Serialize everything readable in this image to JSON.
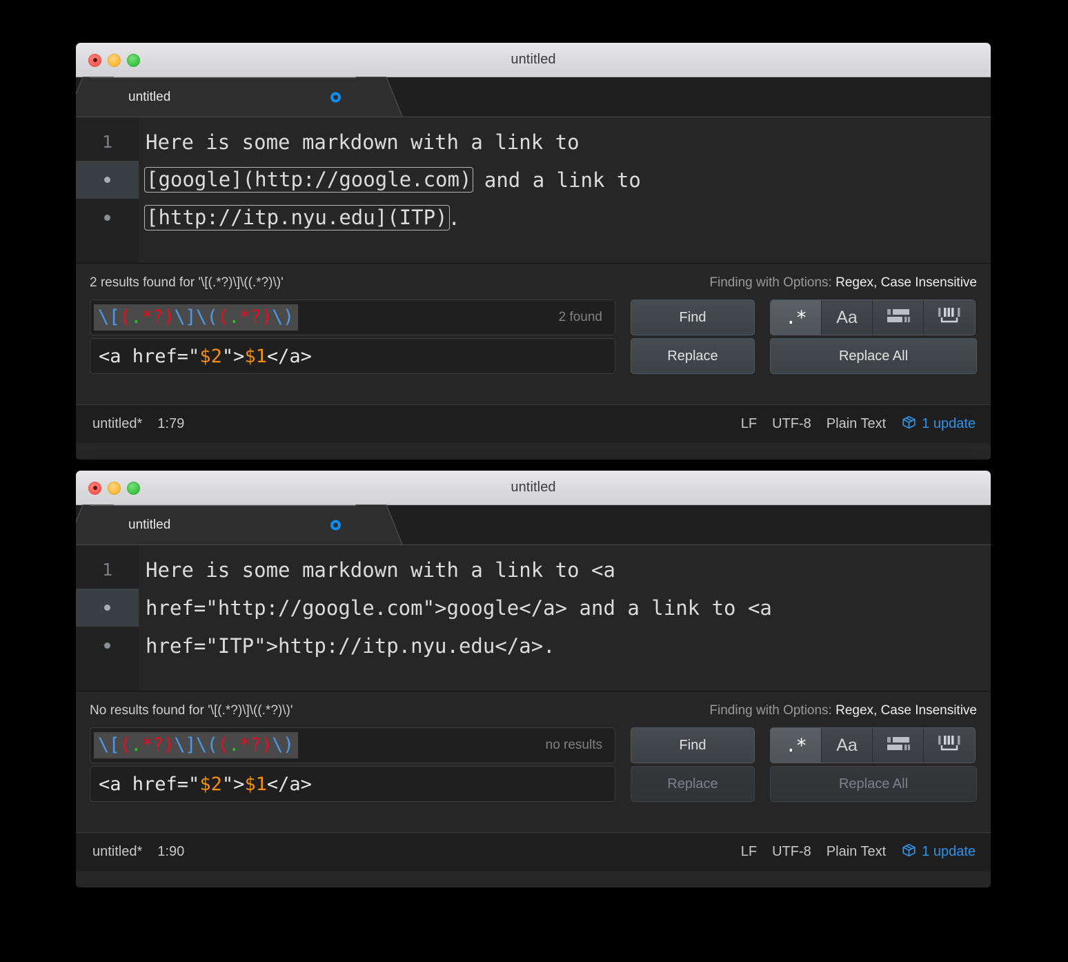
{
  "windows": [
    {
      "title": "untitled",
      "tab": {
        "label": "untitled",
        "dirty_icon": "unsaved-dot-icon"
      },
      "editor": {
        "line_number": "1",
        "lines": [
          {
            "segments": [
              {
                "text": "Here is some markdown with a link to",
                "match": false
              }
            ]
          },
          {
            "segments": [
              {
                "text": "[google](http://google.com)",
                "match": true
              },
              {
                "text": " and a link to",
                "match": false
              }
            ]
          },
          {
            "segments": [
              {
                "text": "[http://itp.nyu.edu](ITP)",
                "match": true
              },
              {
                "text": ".",
                "match": false
              }
            ]
          }
        ]
      },
      "find": {
        "status": "2 results found for '\\[(.*?)\\]\\((.*?)\\)'",
        "options_label": "Finding with Options:",
        "options_value": "Regex, Case Insensitive",
        "query_tokens": [
          {
            "t": "\\[",
            "c": "esc"
          },
          {
            "t": "(",
            "c": "grp"
          },
          {
            "t": ".",
            "c": "dot"
          },
          {
            "t": "*?",
            "c": "grp"
          },
          {
            "t": ")",
            "c": "grp"
          },
          {
            "t": "\\]",
            "c": "esc"
          },
          {
            "t": "\\(",
            "c": "esc"
          },
          {
            "t": "(",
            "c": "grp"
          },
          {
            "t": ".",
            "c": "dot"
          },
          {
            "t": "*?",
            "c": "grp"
          },
          {
            "t": ")",
            "c": "grp"
          },
          {
            "t": "\\)",
            "c": "esc"
          }
        ],
        "query_plain": "\\[(.*?)\\]\\((.*?)\\)",
        "hint": "2 found",
        "replace_tokens": [
          {
            "t": "<a href=\"",
            "c": "plain"
          },
          {
            "t": "$2",
            "c": "var"
          },
          {
            "t": "\">",
            "c": "plain"
          },
          {
            "t": "$1",
            "c": "var"
          },
          {
            "t": "</a>",
            "c": "plain"
          }
        ],
        "replace_plain": "<a href=\"$2\">$1</a>",
        "find_button": "Find",
        "replace_button": "Replace",
        "replace_all_button": "Replace All",
        "replace_enabled": true,
        "toggles": [
          {
            "name": "regex-toggle",
            "glyph": ".*",
            "active": true
          },
          {
            "name": "case-sensitive-toggle",
            "glyph": "Aa",
            "active": false
          },
          {
            "name": "in-selection-toggle",
            "glyph": "in-selection-icon",
            "active": false
          },
          {
            "name": "whole-word-toggle",
            "glyph": "whole-word-icon",
            "active": false
          }
        ]
      },
      "status": {
        "filename": "untitled*",
        "cursor": "1:79",
        "line_ending": "LF",
        "encoding": "UTF-8",
        "syntax": "Plain Text",
        "updates": "1 update",
        "updates_icon": "package-box-icon"
      }
    },
    {
      "title": "untitled",
      "tab": {
        "label": "untitled",
        "dirty_icon": "unsaved-dot-icon"
      },
      "editor": {
        "line_number": "1",
        "lines": [
          {
            "segments": [
              {
                "text": "Here is some markdown with a link to <a",
                "match": false
              }
            ]
          },
          {
            "segments": [
              {
                "text": "href=\"http://google.com\">google</a> and a link to <a",
                "match": false
              }
            ]
          },
          {
            "segments": [
              {
                "text": "href=\"ITP\">http://itp.nyu.edu</a>.",
                "match": false
              }
            ]
          }
        ]
      },
      "find": {
        "status": "No results found for '\\[(.*?)\\]\\((.*?)\\)'",
        "options_label": "Finding with Options:",
        "options_value": "Regex, Case Insensitive",
        "query_tokens": [
          {
            "t": "\\[",
            "c": "esc"
          },
          {
            "t": "(",
            "c": "grp"
          },
          {
            "t": ".",
            "c": "dot"
          },
          {
            "t": "*?",
            "c": "grp"
          },
          {
            "t": ")",
            "c": "grp"
          },
          {
            "t": "\\]",
            "c": "esc"
          },
          {
            "t": "\\(",
            "c": "esc"
          },
          {
            "t": "(",
            "c": "grp"
          },
          {
            "t": ".",
            "c": "dot"
          },
          {
            "t": "*?",
            "c": "grp"
          },
          {
            "t": ")",
            "c": "grp"
          },
          {
            "t": "\\)",
            "c": "esc"
          }
        ],
        "query_plain": "\\[(.*?)\\]\\((.*?)\\)",
        "hint": "no results",
        "replace_tokens": [
          {
            "t": "<a href=\"",
            "c": "plain"
          },
          {
            "t": "$2",
            "c": "var"
          },
          {
            "t": "\">",
            "c": "plain"
          },
          {
            "t": "$1",
            "c": "var"
          },
          {
            "t": "</a>",
            "c": "plain"
          }
        ],
        "replace_plain": "<a href=\"$2\">$1</a>",
        "find_button": "Find",
        "replace_button": "Replace",
        "replace_all_button": "Replace All",
        "replace_enabled": false,
        "toggles": [
          {
            "name": "regex-toggle",
            "glyph": ".*",
            "active": true
          },
          {
            "name": "case-sensitive-toggle",
            "glyph": "Aa",
            "active": false
          },
          {
            "name": "in-selection-toggle",
            "glyph": "in-selection-icon",
            "active": false
          },
          {
            "name": "whole-word-toggle",
            "glyph": "whole-word-icon",
            "active": false
          }
        ]
      },
      "status": {
        "filename": "untitled*",
        "cursor": "1:90",
        "line_ending": "LF",
        "encoding": "UTF-8",
        "syntax": "Plain Text",
        "updates": "1 update",
        "updates_icon": "package-box-icon"
      }
    }
  ],
  "colors": {
    "accent_blue": "#0a8ff6",
    "update_blue": "#2f93e8",
    "regex_escape": "#4a9ae8",
    "regex_group": "#e01020",
    "regex_dot": "#30c030",
    "replace_var": "#f29014",
    "window_bg": "#262626"
  }
}
